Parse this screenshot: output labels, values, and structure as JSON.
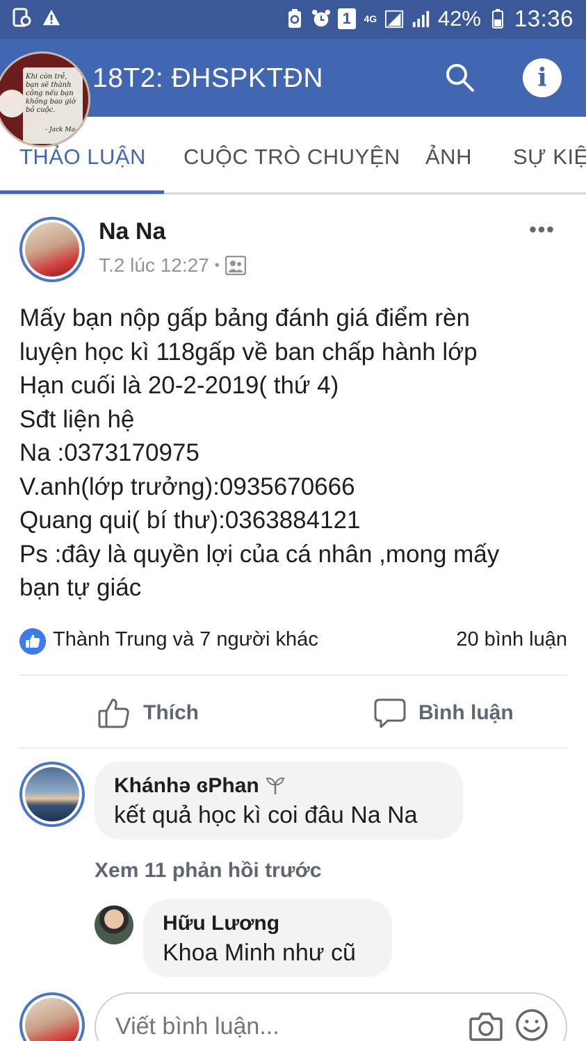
{
  "status_bar": {
    "network": "4G",
    "battery": "42%",
    "time": "13:36",
    "sim_badge": "1"
  },
  "header": {
    "group_name": "18T2: ĐHSPKTĐN",
    "cover_quote": "Khi còn trẻ, bạn sẽ thành công nếu bạn không bao giờ bỏ cuộc.",
    "cover_signature": "- Jack Ma-"
  },
  "tabs": [
    {
      "label": "THẢO LUẬN",
      "active": true
    },
    {
      "label": "CUỘC TRÒ CHUYỆN",
      "active": false
    },
    {
      "label": "ẢNH",
      "active": false
    },
    {
      "label": "SỰ KIỆN",
      "active": false
    }
  ],
  "post": {
    "author": "Na Na",
    "time": "T.2 lúc 12:27",
    "separator": "•",
    "more_label": "•••",
    "body_lines": [
      "Mấy bạn nộp gấp bảng đánh giá điểm rèn",
      "luyện học kì 118gấp về ban chấp hành lớp",
      "Hạn cuối là 20-2-2019( thứ 4)",
      "Sđt liện hệ",
      "Na :0373170975",
      "V.anh(lớp trưởng):0935670666",
      "Quang qui( bí thư):0363884121",
      "Ps :đây là quyền lợi của cá nhân ,mong mấy",
      "bạn tự giác"
    ],
    "reactions_text": "Thành Trung và 7 người khác",
    "comment_count": "20 bình luận",
    "like_label": "Thích",
    "comment_label": "Bình luận"
  },
  "comments": [
    {
      "name": "Khánhə ɞPhan",
      "text": "kết quả học kì coi đâu Na Na"
    }
  ],
  "view_more": "Xem 11 phản hồi trước",
  "replies": [
    {
      "name": "Hữu Lương",
      "text": "Khoa Minh như cũ"
    }
  ],
  "composer": {
    "placeholder": "Viết bình luận..."
  },
  "colors": {
    "brand": "#4267b2",
    "status_bar": "#3b5998",
    "like_blue": "#3b7bf0",
    "bubble": "#f2f3f5"
  }
}
